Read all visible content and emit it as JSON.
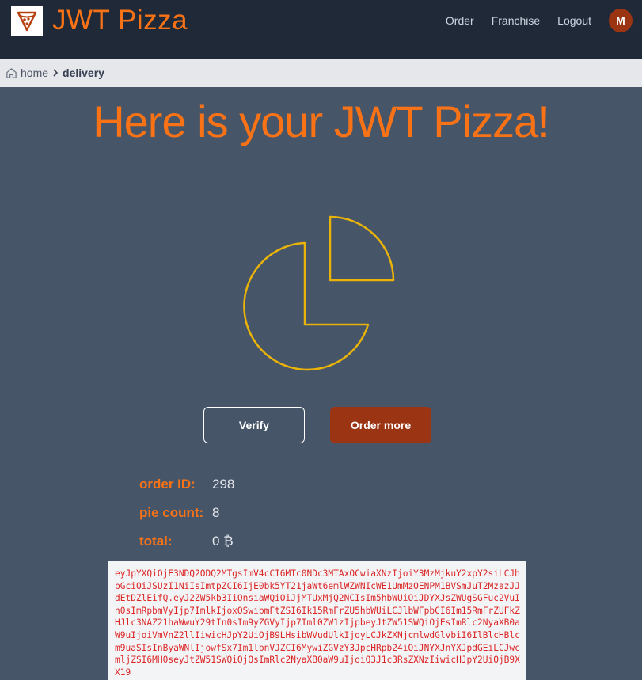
{
  "header": {
    "brand": "JWT Pizza",
    "nav": [
      "Order",
      "Franchise",
      "Logout"
    ],
    "avatar_initial": "M"
  },
  "breadcrumb": {
    "home": "home",
    "current": "delivery"
  },
  "main": {
    "title": "Here is your JWT Pizza!",
    "buttons": {
      "verify": "Verify",
      "order_more": "Order more"
    },
    "order": {
      "id_label": "order ID:",
      "id_value": "298",
      "count_label": "pie count:",
      "count_value": "8",
      "total_label": "total:",
      "total_value": "0 ₿"
    },
    "jwt": "eyJpYXQiOjE3NDQ2ODQ2MTgsImV4cCI6MTc0NDc3MTAxOCwiaXNzIjoiY3MzMjkuY2xpY2siLCJhbGciOiJSUzI1NiIsImtpZCI6IjE0bk5YT21jaWt6emlWZWNIcWE1UmMzOENPM1BVSmJuT2MzazJJdEtDZlEifQ.eyJ2ZW5kb3IiOnsiaWQiOiJjMTUxMjQ2NCIsIm5hbWUiOiJDYXJsZWUgSGFuc2VuIn0sImRpbmVyIjp7ImlkIjoxOSwibmFtZSI6Ik15RmFrZU5hbWUiLCJlbWFpbCI6Im15RmFrZUFkZHJlc3NAZ21haWwuY29tIn0sIm9yZGVyIjp7Iml0ZW1zIjpbeyJtZW51SWQiOjEsImRlc2NyaXB0aW9uIjoiVmVnZ2llIiwicHJpY2UiOjB9LHsibWVudUlkIjoyLCJkZXNjcmlwdGlvbiI6IlBlcHBlcm9uaSIsInByaWNlIjowfSx7Im1lbnVJZCI6MywiZGVzY3JpcHRpb24iOiJNYXJnYXJpdGEiLCJwcmljZSI6MH0seyJtZW51SWQiOjQsImRlc2NyaXB0aW9uIjoiQ3J1c3RsZXNzIiwicHJpY2UiOjB9XX19",
    "colors": {
      "accent": "#f97316",
      "pie_stroke": "#eab308",
      "order_button": "#9a3412"
    }
  }
}
